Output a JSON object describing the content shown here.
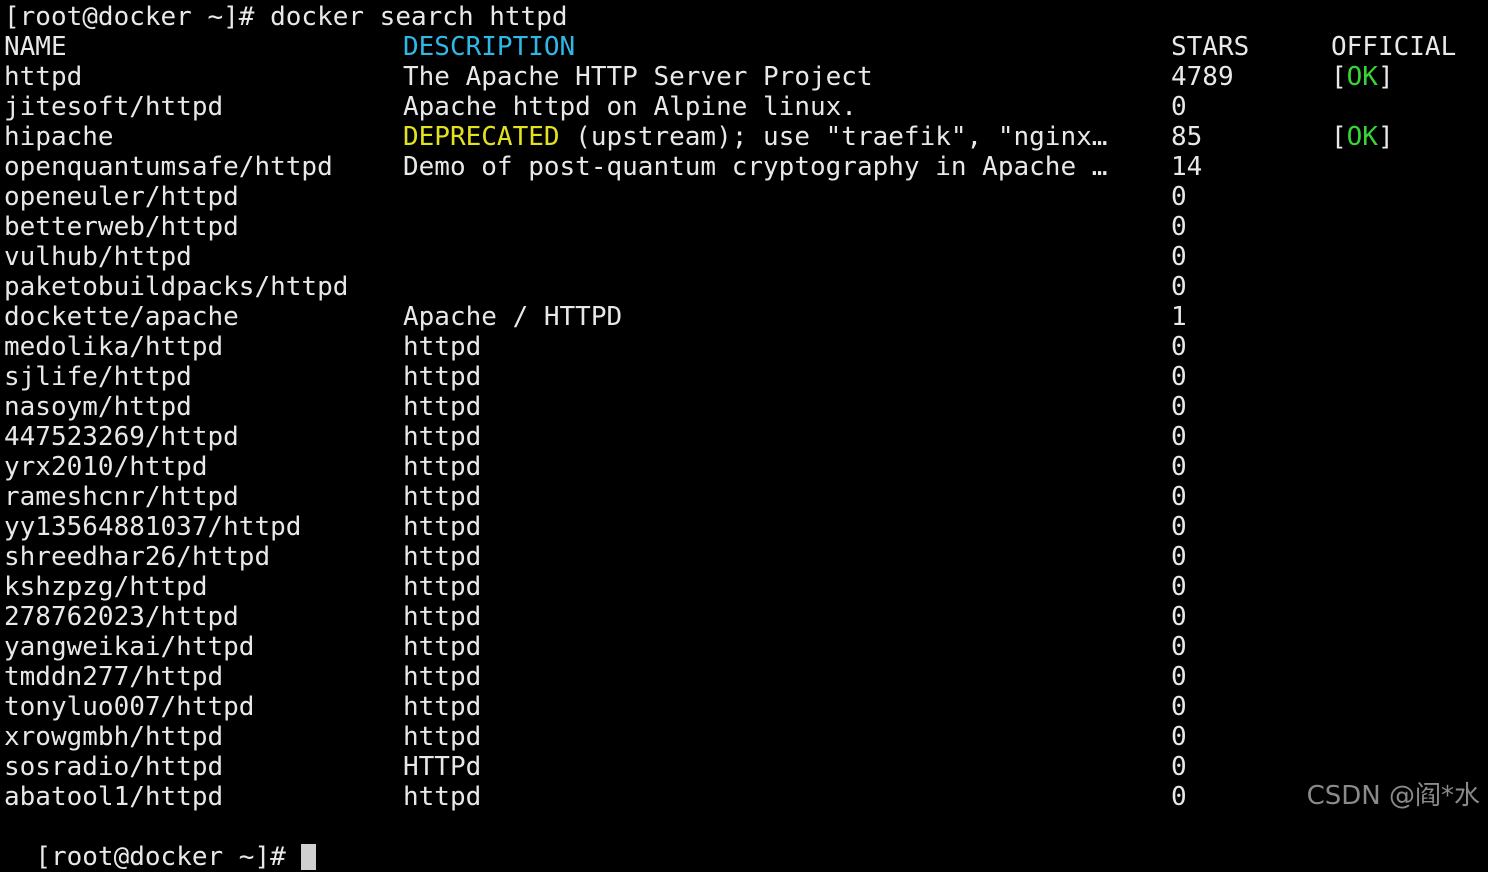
{
  "prompt": "[root@docker ~]# docker search httpd",
  "headers": {
    "name": "NAME",
    "description": "DESCRIPTION",
    "stars": "STARS",
    "official": "OFFICIAL"
  },
  "rows": [
    {
      "name": "httpd",
      "desc_prefix": "",
      "desc": "The Apache HTTP Server Project",
      "stars": "4789",
      "official_open": "[",
      "official_ok": "OK",
      "official_close": "]"
    },
    {
      "name": "jitesoft/httpd",
      "desc_prefix": "",
      "desc": "Apache httpd on Alpine linux.",
      "stars": "0",
      "official_open": "",
      "official_ok": "",
      "official_close": ""
    },
    {
      "name": "hipache",
      "desc_prefix": "DEPRECATED",
      "desc": " (upstream); use \"traefik\", \"nginx…",
      "stars": "85",
      "official_open": "[",
      "official_ok": "OK",
      "official_close": "]"
    },
    {
      "name": "openquantumsafe/httpd",
      "desc_prefix": "",
      "desc": "Demo of post-quantum cryptography in Apache …",
      "stars": "14",
      "official_open": "",
      "official_ok": "",
      "official_close": ""
    },
    {
      "name": "openeuler/httpd",
      "desc_prefix": "",
      "desc": "",
      "stars": "0",
      "official_open": "",
      "official_ok": "",
      "official_close": ""
    },
    {
      "name": "betterweb/httpd",
      "desc_prefix": "",
      "desc": "",
      "stars": "0",
      "official_open": "",
      "official_ok": "",
      "official_close": ""
    },
    {
      "name": "vulhub/httpd",
      "desc_prefix": "",
      "desc": "",
      "stars": "0",
      "official_open": "",
      "official_ok": "",
      "official_close": ""
    },
    {
      "name": "paketobuildpacks/httpd",
      "desc_prefix": "",
      "desc": "",
      "stars": "0",
      "official_open": "",
      "official_ok": "",
      "official_close": ""
    },
    {
      "name": "dockette/apache",
      "desc_prefix": "",
      "desc": "Apache / HTTPD",
      "stars": "1",
      "official_open": "",
      "official_ok": "",
      "official_close": ""
    },
    {
      "name": "medolika/httpd",
      "desc_prefix": "",
      "desc": "httpd",
      "stars": "0",
      "official_open": "",
      "official_ok": "",
      "official_close": ""
    },
    {
      "name": "sjlife/httpd",
      "desc_prefix": "",
      "desc": "httpd",
      "stars": "0",
      "official_open": "",
      "official_ok": "",
      "official_close": ""
    },
    {
      "name": "nasoym/httpd",
      "desc_prefix": "",
      "desc": "httpd",
      "stars": "0",
      "official_open": "",
      "official_ok": "",
      "official_close": ""
    },
    {
      "name": "447523269/httpd",
      "desc_prefix": "",
      "desc": "httpd",
      "stars": "0",
      "official_open": "",
      "official_ok": "",
      "official_close": ""
    },
    {
      "name": "yrx2010/httpd",
      "desc_prefix": "",
      "desc": "httpd",
      "stars": "0",
      "official_open": "",
      "official_ok": "",
      "official_close": ""
    },
    {
      "name": "rameshcnr/httpd",
      "desc_prefix": "",
      "desc": "httpd",
      "stars": "0",
      "official_open": "",
      "official_ok": "",
      "official_close": ""
    },
    {
      "name": "yy13564881037/httpd",
      "desc_prefix": "",
      "desc": "httpd",
      "stars": "0",
      "official_open": "",
      "official_ok": "",
      "official_close": ""
    },
    {
      "name": "shreedhar26/httpd",
      "desc_prefix": "",
      "desc": "httpd",
      "stars": "0",
      "official_open": "",
      "official_ok": "",
      "official_close": ""
    },
    {
      "name": "kshzpzg/httpd",
      "desc_prefix": "",
      "desc": "httpd",
      "stars": "0",
      "official_open": "",
      "official_ok": "",
      "official_close": ""
    },
    {
      "name": "278762023/httpd",
      "desc_prefix": "",
      "desc": "httpd",
      "stars": "0",
      "official_open": "",
      "official_ok": "",
      "official_close": ""
    },
    {
      "name": "yangweikai/httpd",
      "desc_prefix": "",
      "desc": "httpd",
      "stars": "0",
      "official_open": "",
      "official_ok": "",
      "official_close": ""
    },
    {
      "name": "tmddn277/httpd",
      "desc_prefix": "",
      "desc": "httpd",
      "stars": "0",
      "official_open": "",
      "official_ok": "",
      "official_close": ""
    },
    {
      "name": "tonyluo007/httpd",
      "desc_prefix": "",
      "desc": "httpd",
      "stars": "0",
      "official_open": "",
      "official_ok": "",
      "official_close": ""
    },
    {
      "name": "xrowgmbh/httpd",
      "desc_prefix": "",
      "desc": "httpd",
      "stars": "0",
      "official_open": "",
      "official_ok": "",
      "official_close": ""
    },
    {
      "name": "sosradio/httpd",
      "desc_prefix": "",
      "desc": "HTTPd",
      "stars": "0",
      "official_open": "",
      "official_ok": "",
      "official_close": ""
    },
    {
      "name": "abatool1/httpd",
      "desc_prefix": "",
      "desc": "httpd",
      "stars": "0",
      "official_open": "",
      "official_ok": "",
      "official_close": ""
    }
  ],
  "next_prompt": "[root@docker ~]# ",
  "watermark": "CSDN @阎*水",
  "colors": {
    "background": "#000000",
    "text": "#e8e8e8",
    "header_description": "#2fb7e6",
    "deprecated": "#e3e31d",
    "ok": "#37d437"
  }
}
